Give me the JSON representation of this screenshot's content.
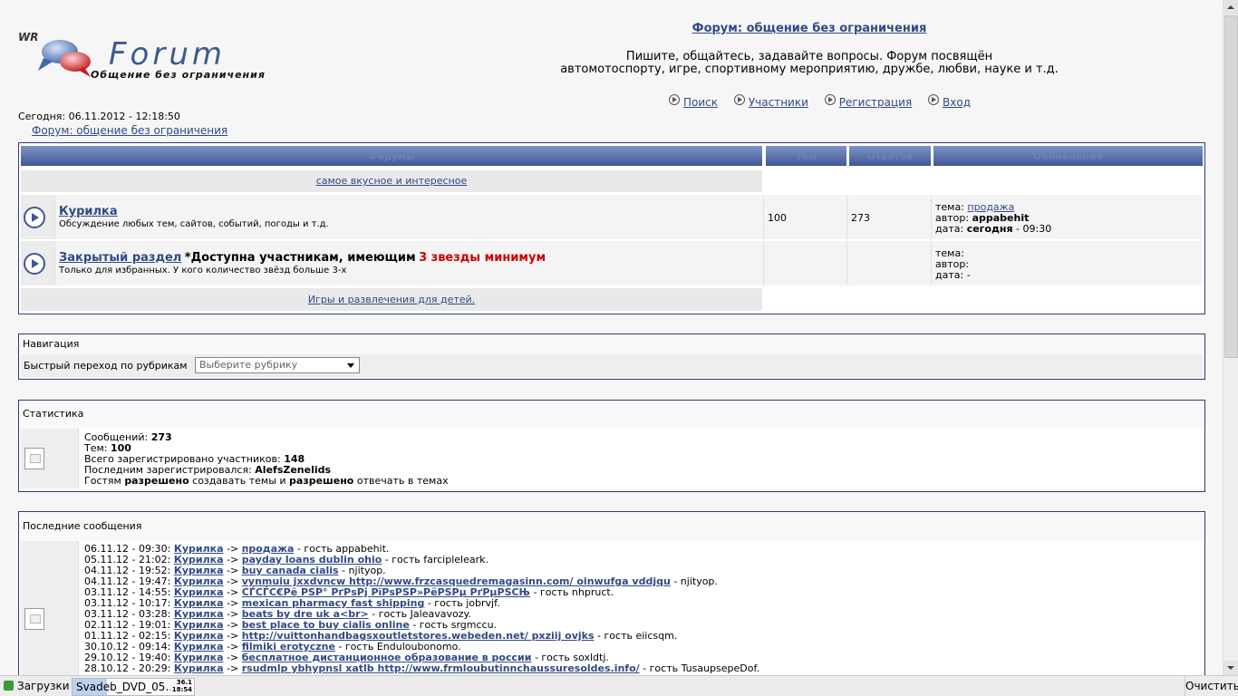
{
  "header": {
    "logo_wr": "WR",
    "logo_forum": "Forum",
    "logo_slogan": "Общение без ограничения",
    "title": "Форум: общение без ограничения",
    "desc_line1": "Пишите, общайтесь, задавайте вопросы. Форум посвящён",
    "desc_line2": "автомотоспорту, игре, спортивному мероприятию, дружбе, любви, науке и т.д.",
    "nav": [
      "Поиск",
      "Участники",
      "Регистрация",
      "Вход"
    ]
  },
  "today": "Сегодня: 06.11.2012 - 12:18:50",
  "breadcrumb": "Форум: общение без ограничения",
  "forum_table": {
    "headers": [
      "Форумы",
      "Тем",
      "Ответов",
      "Обновление"
    ],
    "category1": "самое вкусное и интересное",
    "category2": "Игры и развлечения для детей.",
    "rows": [
      {
        "title": "Курилка",
        "desc": "Обсуждение любых тем, сайтов, событий, погоды и т.д.",
        "topics": "100",
        "replies": "273",
        "upd_topic_label": "тема:",
        "upd_topic": "продажа",
        "upd_author_label": "автор:",
        "upd_author": "appabehit",
        "upd_date_label": "дата:",
        "upd_date_bold": "сегодня",
        "upd_date_rest": "- 09:30"
      },
      {
        "title": "Закрытый раздел",
        "title_extra": "*Доступна участникам, имеющим",
        "title_red": "3 звезды минимум",
        "desc": "Только для избранных. У кого количество звёзд больше 3-х",
        "upd_topic_label": "тема:",
        "upd_author_label": "автор:",
        "upd_date_label": "дата: -"
      }
    ]
  },
  "navigation": {
    "title": "Навигация",
    "jump_label": "Быстрый переход по рубрикам",
    "select_value": "Выберите рубрику"
  },
  "stats": {
    "title": "Статистика",
    "messages_label": "Сообщений:",
    "messages": "273",
    "topics_label": "Тем:",
    "topics": "100",
    "members_label": "Всего зарегистрировано участников:",
    "members": "148",
    "last_label": "Последним зарегистрировался:",
    "last": "AlefsZenelids",
    "guests_1": "Гостям",
    "guests_allowed": "разрешено",
    "guests_2": "создавать темы и",
    "guests_3": "отвечать в темах"
  },
  "recent": {
    "title": "Последние сообщения",
    "arrow": "->",
    "guest_word": "- гость",
    "items": [
      {
        "date": "06.11.12 - 09:30:",
        "forum": "Курилка",
        "topic": "продажа",
        "author": "appabehit."
      },
      {
        "date": "05.11.12 - 21:02:",
        "forum": "Курилка",
        "topic": "payday loans dublin ohio",
        "author": "farcipleleark."
      },
      {
        "date": "04.11.12 - 19:52:",
        "forum": "Курилка",
        "topic": "buy canada cialis",
        "author": "- njityop.",
        "no_guest": true
      },
      {
        "date": "04.11.12 - 19:47:",
        "forum": "Курилка",
        "topic": "vynmuiu jxxdvncw http://www.frzcasquedremagasinn.com/ oinwufga vddjqu",
        "author": "- njityop.",
        "no_guest": true
      },
      {
        "date": "03.11.12 - 14:55:",
        "forum": "Курилка",
        "topic": "СЃСЃС€Рё РЅР° РґРѕРј РїРѕРЅР»РёРЅРµ РґРµРЅСЊ",
        "author": "nhpruct."
      },
      {
        "date": "03.11.12 - 10:17:",
        "forum": "Курилка",
        "topic": "mexican pharmacy fast shipping",
        "author": "jobrvjf."
      },
      {
        "date": "03.11.12 - 03:28:",
        "forum": "Курилка",
        "topic": "beats by dre uk a<br>",
        "author": "Jaleavavozy."
      },
      {
        "date": "02.11.12 - 19:01:",
        "forum": "Курилка",
        "topic": "best place to buy cialis online",
        "author": "srgmccu."
      },
      {
        "date": "01.11.12 - 02:15:",
        "forum": "Курилка",
        "topic": "http://vuittonhandbagsxoutletstores.webeden.net/ pxziij ovjks",
        "author": "eiicsqm."
      },
      {
        "date": "30.10.12 - 09:14:",
        "forum": "Курилка",
        "topic": "filmiki erotyczne",
        "author": "Enduloubonomo."
      },
      {
        "date": "29.10.12 - 19:40:",
        "forum": "Курилка",
        "topic": "бесплатное дистанционное образование в россии",
        "author": "soxldtj."
      },
      {
        "date": "28.10.12 - 20:29:",
        "forum": "Курилка",
        "topic": "rsudmlp ybhypnsl xatlb http://www.frmloubutinnchaussuresoldes.info/",
        "author": "TusaupsepeDof."
      }
    ]
  },
  "downloads": {
    "label": "Загрузки",
    "file": "Svadeb_DVD_05...",
    "size_top": "36.1",
    "size_bottom": "18:54",
    "progress": 0.28,
    "clear": "Очистить"
  },
  "colors": {
    "frame": "#2c3f73",
    "header_gradient_top": "#7f93c6",
    "header_gradient_bottom": "#3f5796",
    "link": "#314a86",
    "accent_red": "#cc0000"
  }
}
